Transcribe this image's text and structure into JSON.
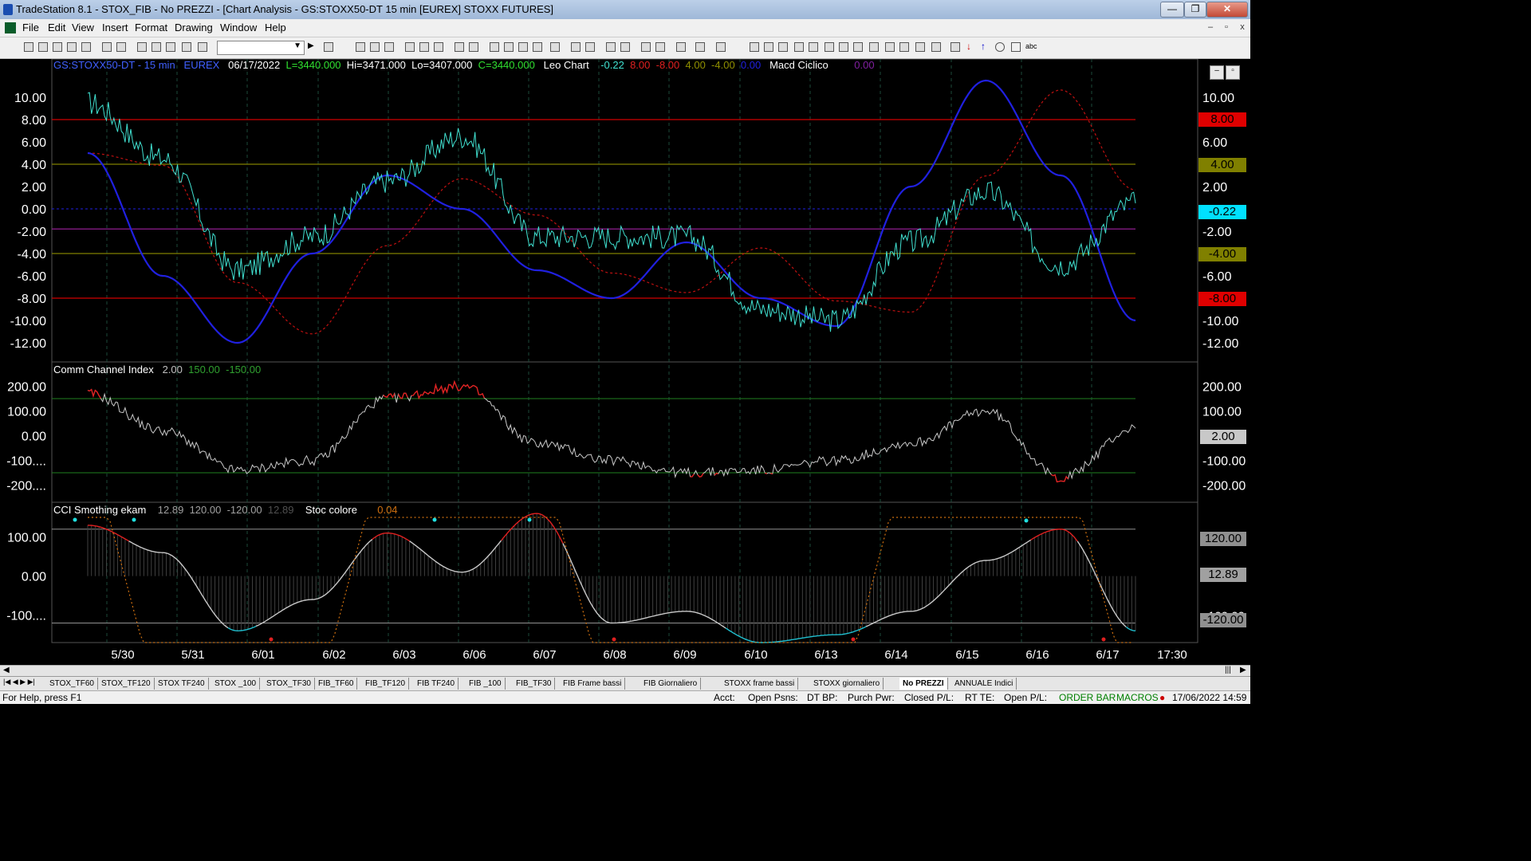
{
  "window": {
    "title": "TradeStation 8.1 - STOX_FIB - No PREZZI - [Chart Analysis - GS:STOXX50-DT  15 min  [EUREX] STOXX FUTURES]",
    "min_label": "—",
    "max_label": "❐",
    "close_label": "✕"
  },
  "menu": {
    "items": [
      "File",
      "Edit",
      "View",
      "Insert",
      "Format",
      "Drawing",
      "Window",
      "Help"
    ],
    "mdi_min": "–",
    "mdi_restore": "▫",
    "mdi_close": "x"
  },
  "colors": {
    "price": "#40e0d0",
    "cycle": "#2020e0",
    "cycle_dotted": "#c01010",
    "red_line": "#d00000",
    "olive_line": "#808000",
    "magenta_line": "#a020a0",
    "cci_white": "#c8c8c8",
    "orange": "#d07010"
  },
  "panel1": {
    "symbol": "GS:STOXX50-DT - 15 min",
    "exchange": "EUREX",
    "date": "06/17/2022",
    "last": "L=3440.000",
    "hi": "Hi=3471.000",
    "lo": "Lo=3407.000",
    "close": "C=3440.000",
    "study1": "Leo Chart",
    "v1": "-0.22",
    "v2": "8.00",
    "v3": "-8.00",
    "v4": "4.00",
    "v5": "-4.00",
    "v6": "0.00",
    "study2": "Macd Ciclico",
    "v7": "0.00",
    "y_ticks": [
      "10.00",
      "8.00",
      "6.00",
      "4.00",
      "2.00",
      "0.00",
      "-2.00",
      "-4.00",
      "-6.00",
      "-8.00",
      "-10.00",
      "-12.00"
    ],
    "right_boxes": {
      "r8": "8.00",
      "r4": "4.00",
      "cur": "-0.22",
      "rm4": "-4.00",
      "rm8": "-8.00"
    }
  },
  "panel2": {
    "study": "Comm Channel Index",
    "v1": "2.00",
    "v2": "150.00",
    "v3": "-150.00",
    "y_ticks": [
      "200.00",
      "100.00",
      "0.00",
      "-100....",
      "-200...."
    ],
    "right_ticks": [
      "200.00",
      "100.00",
      "-100.00",
      "-200.00"
    ],
    "right_box": "2.00"
  },
  "panel3": {
    "study1": "CCI Smothing ekam",
    "v1": "12.89",
    "v2": "120.00",
    "v3": "-120.00",
    "v4": "12.89",
    "study2": "Stoc colore",
    "v5": "0.04",
    "y_ticks": [
      "100.00",
      "0.00",
      "-100...."
    ],
    "right_box_top": "120.00",
    "right_box_cur": "12.89",
    "right_box_bot": "-120.00",
    "right_tick_m100": "-100.00"
  },
  "x_axis": [
    "5/30",
    "5/31",
    "6/01",
    "6/02",
    "6/03",
    "6/06",
    "6/07",
    "6/08",
    "6/09",
    "6/10",
    "6/13",
    "6/14",
    "6/15",
    "6/16",
    "6/17",
    "17:30"
  ],
  "chart_data": [
    {
      "type": "line",
      "title": "Leo Chart / Macd Ciclico",
      "x": [
        "5/30",
        "5/31",
        "6/01",
        "6/02",
        "6/03",
        "6/06",
        "6/07",
        "6/08",
        "6/09",
        "6/10",
        "6/13",
        "6/14",
        "6/15",
        "6/16",
        "6/17"
      ],
      "ylim": [
        -13,
        12
      ],
      "series": [
        {
          "name": "Leo Chart",
          "values": [
            9.5,
            4.5,
            -5.5,
            -2.5,
            2.5,
            6.5,
            -2.5,
            -2.5,
            -2.5,
            -9.0,
            -10.0,
            -3.0,
            1.5,
            -5.0,
            0.5
          ]
        },
        {
          "name": "Macd Ciclico",
          "values": [
            5.0,
            -6.0,
            -12.0,
            -4.0,
            3.0,
            0.0,
            -5.5,
            -8.0,
            -3.0,
            -8.0,
            -10.5,
            2.0,
            11.5,
            3.0,
            -10.0
          ]
        }
      ]
    },
    {
      "type": "line",
      "title": "Comm Channel Index",
      "x": [
        "5/30",
        "5/31",
        "6/01",
        "6/02",
        "6/03",
        "6/06",
        "6/07",
        "6/08",
        "6/09",
        "6/10",
        "6/13",
        "6/14",
        "6/15",
        "6/16",
        "6/17"
      ],
      "ylim": [
        -250,
        250
      ],
      "series": [
        {
          "name": "Comm Channel Index",
          "values": [
            170,
            20,
            -140,
            -100,
            150,
            200,
            -30,
            -100,
            -150,
            -140,
            -100,
            -30,
            100,
            -170,
            30
          ]
        }
      ]
    },
    {
      "type": "line",
      "title": "CCI Smothing ekam / Stoc colore",
      "x": [
        "5/30",
        "5/31",
        "6/01",
        "6/02",
        "6/03",
        "6/06",
        "6/07",
        "6/08",
        "6/09",
        "6/10",
        "6/13",
        "6/14",
        "6/15",
        "6/16",
        "6/17"
      ],
      "ylim": [
        -170,
        150
      ],
      "series": [
        {
          "name": "CCI Smothing ekam",
          "values": [
            130,
            60,
            -140,
            -60,
            110,
            10,
            160,
            -120,
            -90,
            -170,
            -150,
            -90,
            40,
            120,
            -140
          ]
        },
        {
          "name": "Stoc colore",
          "values": [
            180,
            -180,
            -180,
            -180,
            180,
            180,
            180,
            -180,
            -180,
            -180,
            -180,
            180,
            180,
            180,
            -180
          ]
        }
      ]
    }
  ],
  "tabs": [
    "STOX_TF60",
    "STOX_TF120",
    "STOX TF240",
    "STOX _100",
    "STOX_TF30",
    "FIB_TF60",
    "FIB_TF120",
    "FIB TF240",
    "FIB _100",
    "FIB_TF30",
    "FIB Frame bassi",
    "FIB Giornaliero",
    "STOXX frame bassi",
    "STOXX giornaliero",
    "No PREZZI",
    "ANNUALE Indici"
  ],
  "active_tab": "No PREZZI",
  "status": {
    "help": "For Help, press F1",
    "acct": "Acct:",
    "open_psns": "Open Psns:",
    "dt_bp": "DT BP:",
    "purch_pwr": "Purch Pwr:",
    "closed_pl": "Closed P/L:",
    "rt_te": "RT TE:",
    "open_pl": "Open P/L:",
    "order_bar": "ORDER BAR",
    "macros": "MACROS",
    "datetime": "17/06/2022 14:59"
  }
}
